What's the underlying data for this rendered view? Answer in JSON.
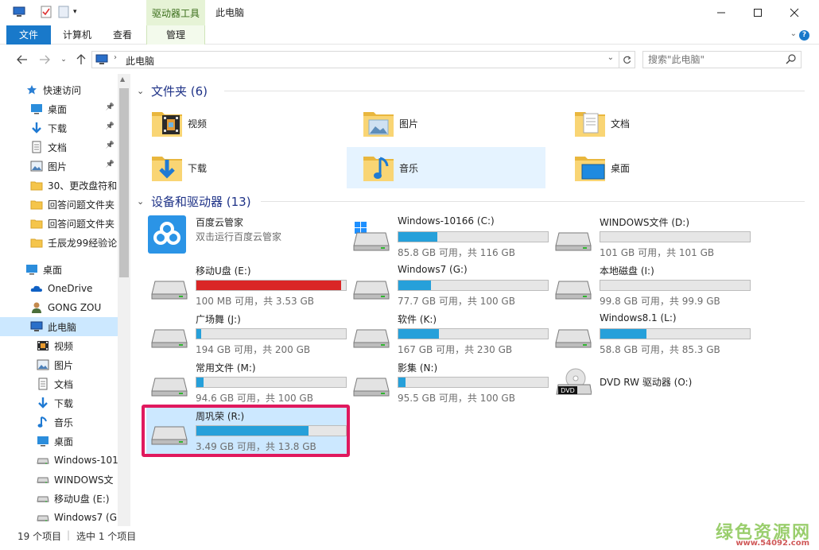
{
  "titlebar": {
    "drive_tools_tab": "驱动器工具",
    "window_title": "此电脑",
    "minimize": "—",
    "maximize": "☐",
    "close": "✕"
  },
  "ribbon": {
    "tabs": [
      "文件",
      "计算机",
      "查看",
      "管理"
    ]
  },
  "address": {
    "crumb": "此电脑",
    "search_placeholder": "搜索\"此电脑\""
  },
  "nav": {
    "quick_access": "快速访问",
    "pinned": [
      {
        "label": "桌面",
        "icon": "desktop-icon"
      },
      {
        "label": "下载",
        "icon": "download-icon"
      },
      {
        "label": "文档",
        "icon": "document-icon"
      },
      {
        "label": "图片",
        "icon": "picture-icon"
      }
    ],
    "recent_folders": [
      "30、更改盘符和",
      "回答问题文件夹",
      "回答问题文件夹",
      "壬辰龙99经验论"
    ],
    "desktop": "桌面",
    "onedrive": "OneDrive",
    "user": "GONG ZOU",
    "this_pc": "此电脑",
    "pc_children": [
      {
        "label": "视频",
        "icon": "video-icon"
      },
      {
        "label": "图片",
        "icon": "picture-icon"
      },
      {
        "label": "文档",
        "icon": "document-icon"
      },
      {
        "label": "下载",
        "icon": "download-icon"
      },
      {
        "label": "音乐",
        "icon": "music-icon"
      },
      {
        "label": "桌面",
        "icon": "desktop-icon"
      },
      {
        "label": "Windows-101",
        "icon": "drive-icon"
      },
      {
        "label": "WINDOWS文",
        "icon": "drive-icon"
      },
      {
        "label": "移动U盘 (E:)",
        "icon": "drive-icon"
      },
      {
        "label": "Windows7 (G",
        "icon": "drive-icon"
      }
    ]
  },
  "content": {
    "folders_header": "文件夹 (6)",
    "folders": [
      {
        "label": "视频",
        "icon": "video-folder-icon"
      },
      {
        "label": "图片",
        "icon": "picture-folder-icon"
      },
      {
        "label": "文档",
        "icon": "document-folder-icon"
      },
      {
        "label": "下载",
        "icon": "download-folder-icon"
      },
      {
        "label": "音乐",
        "icon": "music-folder-icon"
      },
      {
        "label": "桌面",
        "icon": "desktop-folder-icon"
      }
    ],
    "drives_header": "设备和驱动器 (13)",
    "drives": [
      {
        "name": "百度云管家",
        "desc": "双击运行百度云管家",
        "type": "app",
        "icon": "baidu-cloud-icon"
      },
      {
        "name": "Windows-10166 (C:)",
        "size": "85.8 GB 可用，共 116 GB",
        "used": 0.26,
        "type": "system",
        "icon": "windows-drive-icon"
      },
      {
        "name": "WINDOWS文件 (D:)",
        "size": "101 GB 可用，共 101 GB",
        "used": 0.0,
        "type": "drive",
        "icon": "drive-icon"
      },
      {
        "name": "移动U盘 (E:)",
        "size": "100 MB 可用，共 3.53 GB",
        "used": 0.97,
        "type": "drive",
        "warn": true,
        "icon": "drive-icon"
      },
      {
        "name": "Windows7 (G:)",
        "size": "77.7 GB 可用，共 100 GB",
        "used": 0.22,
        "type": "drive",
        "icon": "drive-icon"
      },
      {
        "name": "本地磁盘 (I:)",
        "size": "99.8 GB 可用，共 99.9 GB",
        "used": 0.0,
        "type": "drive",
        "icon": "drive-icon"
      },
      {
        "name": "广场舞 (J:)",
        "size": "194 GB 可用，共 200 GB",
        "used": 0.03,
        "type": "drive",
        "icon": "drive-icon"
      },
      {
        "name": "软件 (K:)",
        "size": "167 GB 可用，共 230 GB",
        "used": 0.27,
        "type": "drive",
        "icon": "drive-icon"
      },
      {
        "name": "Windows8.1 (L:)",
        "size": "58.8 GB 可用，共 85.3 GB",
        "used": 0.31,
        "type": "drive",
        "icon": "drive-icon"
      },
      {
        "name": "常用文件 (M:)",
        "size": "94.6 GB 可用，共 100 GB",
        "used": 0.05,
        "type": "drive",
        "icon": "drive-icon"
      },
      {
        "name": "影集 (N:)",
        "size": "95.5 GB 可用，共 100 GB",
        "used": 0.05,
        "type": "drive",
        "icon": "drive-icon"
      },
      {
        "name": "DVD RW 驱动器 (O:)",
        "type": "dvd",
        "icon": "dvd-drive-icon",
        "badge": "DVD"
      },
      {
        "name": "周巩荣 (R:)",
        "size": "3.49 GB 可用，共 13.8 GB",
        "used": 0.75,
        "type": "drive",
        "selected": true,
        "icon": "drive-icon"
      }
    ]
  },
  "status": {
    "count": "19 个项目",
    "selected": "选中 1 个项目"
  },
  "watermark": {
    "cn": "绿色资源网",
    "url": "www.54092.com"
  },
  "colors": {
    "accent": "#1979ca",
    "bar_fill": "#26a0da",
    "bar_warn": "#da2626",
    "highlight": "#e0195e",
    "section_header": "#1e3287"
  }
}
